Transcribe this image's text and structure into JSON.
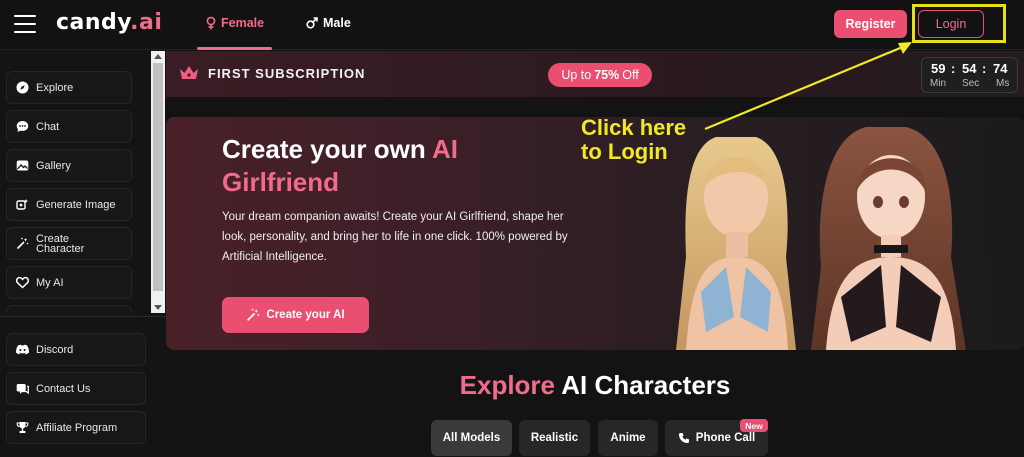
{
  "header": {
    "logo_main": "candy",
    "logo_accent": ".ai",
    "tabs": [
      {
        "label": "Female",
        "icon": "female-icon",
        "active": true
      },
      {
        "label": "Male",
        "icon": "male-icon",
        "active": false
      }
    ],
    "register_label": "Register",
    "login_label": "Login"
  },
  "sidebar": {
    "items": [
      {
        "label": "Explore",
        "icon": "compass-icon"
      },
      {
        "label": "Chat",
        "icon": "chat-icon"
      },
      {
        "label": "Gallery",
        "icon": "gallery-icon"
      },
      {
        "label": "Generate Image",
        "icon": "generate-image-icon"
      },
      {
        "label_line1": "Create",
        "label_line2": "Character",
        "icon": "magic-wand-icon"
      },
      {
        "label": "My AI",
        "icon": "heart-icon"
      }
    ],
    "bottom_items": [
      {
        "label": "Discord",
        "icon": "discord-icon"
      },
      {
        "label": "Contact Us",
        "icon": "contact-icon"
      },
      {
        "label": "Affiliate Program",
        "icon": "trophy-icon"
      }
    ]
  },
  "promo": {
    "title": "FIRST SUBSCRIPTION",
    "pill_prefix": "Up to",
    "pill_value": "75%",
    "pill_suffix": "Off",
    "timer": {
      "min": "59",
      "sec": "54",
      "ms": "74",
      "min_label": "Min",
      "sec_label": "Sec",
      "ms_label": "Ms"
    }
  },
  "hero": {
    "title_part1": "Create your own",
    "title_accent": "AI",
    "title_line2": "Girlfriend",
    "description": "Your dream companion awaits! Create your AI Girlfriend, shape her look, personality, and bring her to life in one click. 100% powered by Artificial Intelligence.",
    "cta_label": "Create your AI"
  },
  "annotation": {
    "line1": "Click here",
    "line2": "to Login"
  },
  "explore": {
    "heading_accent": "Explore",
    "heading_rest": "AI Characters",
    "filters": [
      {
        "label": "All Models",
        "active": true
      },
      {
        "label": "Realistic",
        "active": false
      },
      {
        "label": "Anime",
        "active": false
      },
      {
        "label": "Phone Call",
        "active": false,
        "icon": "phone-icon",
        "badge": "New"
      }
    ]
  },
  "colors": {
    "accent": "#ea4f72",
    "accent_text": "#f26b8a",
    "annotation": "#f1e82a",
    "background": "#131313"
  }
}
